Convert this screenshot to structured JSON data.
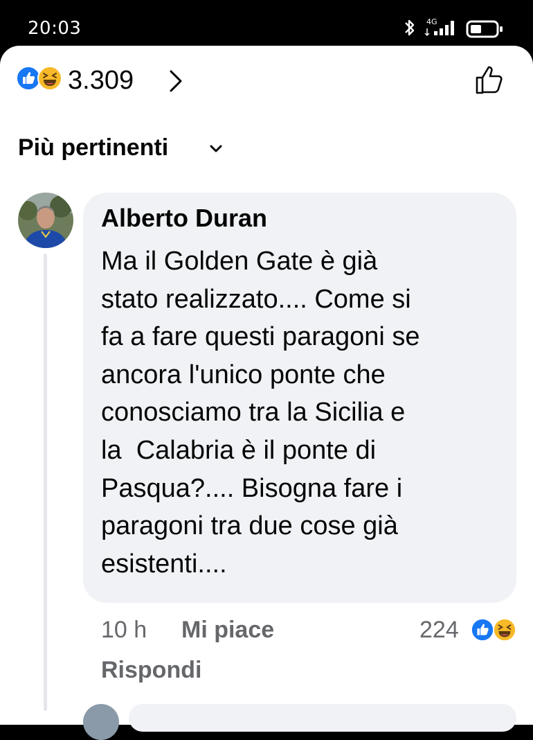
{
  "status_bar": {
    "time": "20:03",
    "network": "4G",
    "icons": [
      "bluetooth-icon",
      "signal-icon",
      "battery-icon"
    ]
  },
  "reactions": {
    "icons": [
      "like-icon",
      "haha-icon"
    ],
    "count": "3.309"
  },
  "sort": {
    "label": "Più pertinenti"
  },
  "comment": {
    "author": "Alberto Duran",
    "text": "Ma il Golden Gate è già\nstato realizzato.... Come si\nfa a fare questi paragoni se\nancora l'unico ponte che\nconosciamo tra la Sicilia e\nla  Calabria è il ponte di\nPasqua?.... Bisogna fare i\nparagoni tra due cose già\nesistenti....",
    "time": "10 h",
    "like_label": "Mi piace",
    "reply_label": "Rispondi",
    "reaction_count": "224"
  },
  "colors": {
    "like_blue": "#1877f2",
    "haha_yellow": "#f7b928",
    "bubble": "#f0f2f5",
    "secondary_text": "#65676b"
  }
}
